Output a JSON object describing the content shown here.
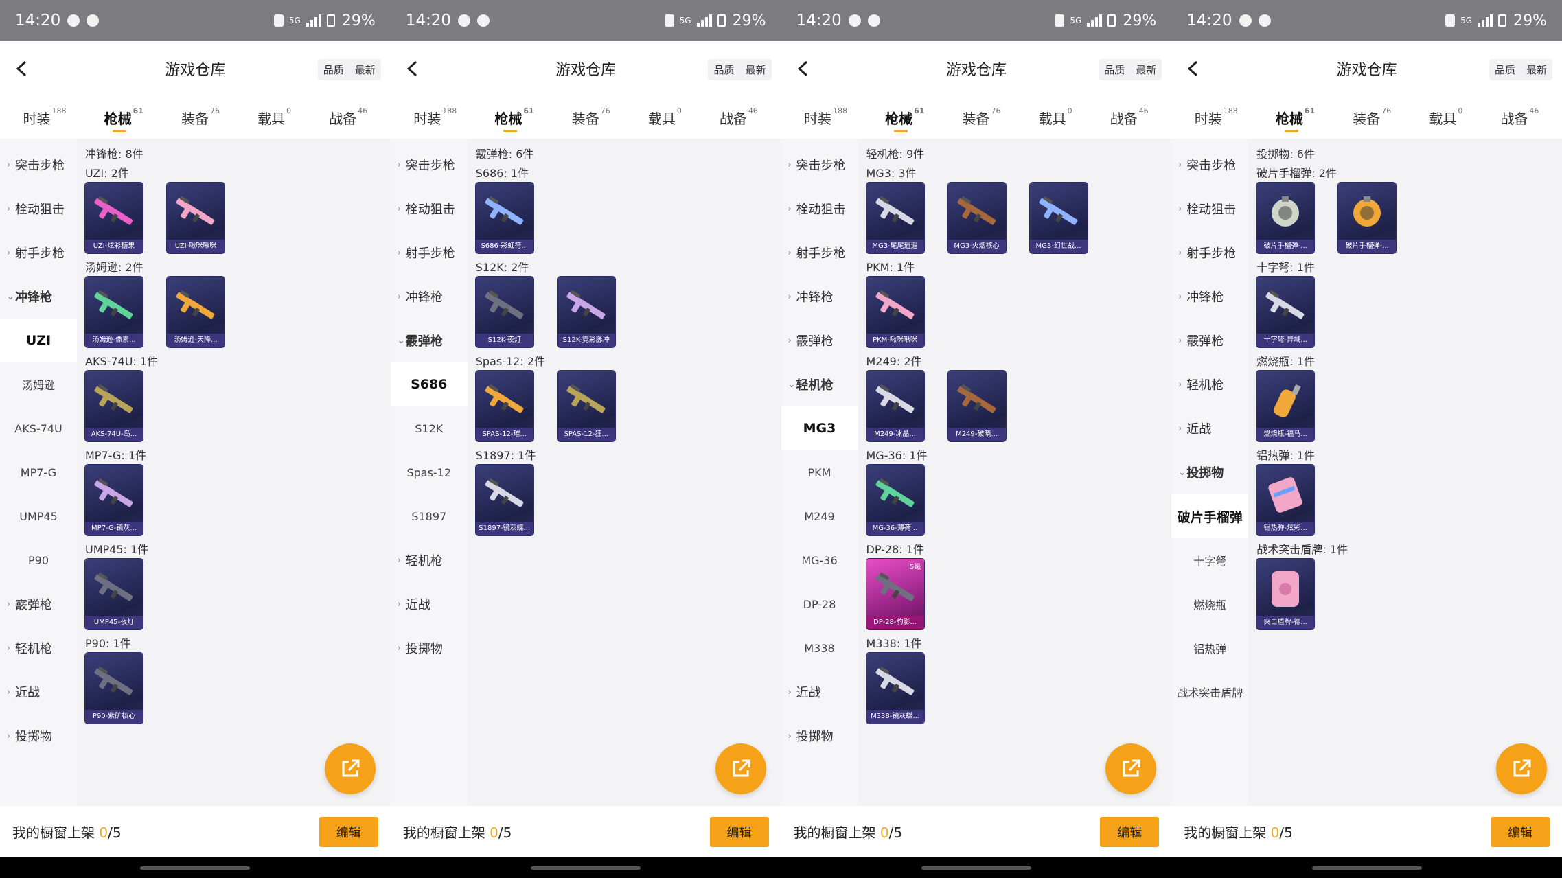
{
  "status": {
    "time": "14:20",
    "battery": "29%",
    "net": "5G"
  },
  "header": {
    "title": "游戏仓库",
    "sort_quality": "品质",
    "sort_latest": "最新"
  },
  "tabs": [
    {
      "label": "时装",
      "count": "188"
    },
    {
      "label": "枪械",
      "count": "61"
    },
    {
      "label": "装备",
      "count": "76"
    },
    {
      "label": "载具",
      "count": "0"
    },
    {
      "label": "战备",
      "count": "46"
    }
  ],
  "bottom": {
    "prefix": "我的橱窗上架 ",
    "count": "0",
    "suffix": "/5",
    "edit": "编辑"
  },
  "colors": {
    "accent": "#f5a219",
    "card": "#2a2d5e",
    "pink_card": "#c2339f"
  },
  "screens": [
    {
      "sidebar": [
        {
          "type": "cat",
          "label": "突击步枪"
        },
        {
          "type": "cat",
          "label": "栓动狙击"
        },
        {
          "type": "cat",
          "label": "射手步枪"
        },
        {
          "type": "cat",
          "label": "冲锋枪",
          "open": true
        },
        {
          "type": "sub",
          "label": "UZI",
          "sel": true
        },
        {
          "type": "sub",
          "label": "汤姆逊"
        },
        {
          "type": "sub",
          "label": "AKS-74U"
        },
        {
          "type": "sub",
          "label": "MP7-G"
        },
        {
          "type": "sub",
          "label": "UMP45"
        },
        {
          "type": "sub",
          "label": "P90"
        },
        {
          "type": "cat",
          "label": "霰弹枪"
        },
        {
          "type": "cat",
          "label": "轻机枪"
        },
        {
          "type": "cat",
          "label": "近战"
        },
        {
          "type": "cat",
          "label": "投掷物"
        }
      ],
      "content_title": "冲锋枪: 8件",
      "groups": [
        {
          "title": "UZI: 2件",
          "items": [
            {
              "label": "UZI-炫彩糖果",
              "hue": "pink"
            },
            {
              "label": "UZI-啾咪啾咪",
              "hue": "rose"
            }
          ]
        },
        {
          "title": "汤姆逊: 2件",
          "items": [
            {
              "label": "汤姆逊-像素...",
              "hue": "green"
            },
            {
              "label": "汤姆逊-天降...",
              "hue": "gold"
            }
          ]
        },
        {
          "title": "AKS-74U: 1件",
          "items": [
            {
              "label": "AKS-74U-岛...",
              "hue": "olive"
            }
          ]
        },
        {
          "title": "MP7-G: 1件",
          "items": [
            {
              "label": "MP7-G-镜灰...",
              "hue": "lilac"
            }
          ]
        },
        {
          "title": "UMP45: 1件",
          "items": [
            {
              "label": "UMP45-夜灯",
              "hue": "dark"
            }
          ]
        },
        {
          "title": "P90: 1件",
          "items": [
            {
              "label": "P90-紫矿核心",
              "hue": "dark"
            }
          ]
        }
      ]
    },
    {
      "sidebar": [
        {
          "type": "cat",
          "label": "突击步枪"
        },
        {
          "type": "cat",
          "label": "栓动狙击"
        },
        {
          "type": "cat",
          "label": "射手步枪"
        },
        {
          "type": "cat",
          "label": "冲锋枪"
        },
        {
          "type": "cat",
          "label": "霰弹枪",
          "open": true
        },
        {
          "type": "sub",
          "label": "S686",
          "sel": true
        },
        {
          "type": "sub",
          "label": "S12K"
        },
        {
          "type": "sub",
          "label": "Spas-12"
        },
        {
          "type": "sub",
          "label": "S1897"
        },
        {
          "type": "cat",
          "label": "轻机枪"
        },
        {
          "type": "cat",
          "label": "近战"
        },
        {
          "type": "cat",
          "label": "投掷物"
        }
      ],
      "content_title": "霰弹枪: 6件",
      "groups": [
        {
          "title": "S686: 1件",
          "items": [
            {
              "label": "S686-彩虹符...",
              "hue": "blue"
            }
          ]
        },
        {
          "title": "S12K: 2件",
          "items": [
            {
              "label": "S12K-夜灯",
              "hue": "dark"
            },
            {
              "label": "S12K-霓彩脉冲",
              "hue": "lilac"
            }
          ]
        },
        {
          "title": "Spas-12: 2件",
          "items": [
            {
              "label": "SPAS-12-璀...",
              "hue": "gold"
            },
            {
              "label": "SPAS-12-狂...",
              "hue": "olive"
            }
          ]
        },
        {
          "title": "S1897: 1件",
          "items": [
            {
              "label": "S1897-镜灰蝶...",
              "hue": "grey"
            }
          ]
        }
      ]
    },
    {
      "sidebar": [
        {
          "type": "cat",
          "label": "突击步枪"
        },
        {
          "type": "cat",
          "label": "栓动狙击"
        },
        {
          "type": "cat",
          "label": "射手步枪"
        },
        {
          "type": "cat",
          "label": "冲锋枪"
        },
        {
          "type": "cat",
          "label": "霰弹枪"
        },
        {
          "type": "cat",
          "label": "轻机枪",
          "open": true
        },
        {
          "type": "sub",
          "label": "MG3",
          "sel": true
        },
        {
          "type": "sub",
          "label": "PKM"
        },
        {
          "type": "sub",
          "label": "M249"
        },
        {
          "type": "sub",
          "label": "MG-36"
        },
        {
          "type": "sub",
          "label": "DP-28"
        },
        {
          "type": "sub",
          "label": "M338"
        },
        {
          "type": "cat",
          "label": "近战"
        },
        {
          "type": "cat",
          "label": "投掷物"
        }
      ],
      "content_title": "轻机枪: 9件",
      "groups": [
        {
          "title": "MG3: 3件",
          "items": [
            {
              "label": "MG3-尾尾逍遥",
              "hue": "grey"
            },
            {
              "label": "MG3-火烟核心",
              "hue": "brown"
            },
            {
              "label": "MG3-幻世战...",
              "hue": "blue"
            }
          ]
        },
        {
          "title": "PKM: 1件",
          "items": [
            {
              "label": "PKM-啾咪啾咪",
              "hue": "rose"
            }
          ]
        },
        {
          "title": "M249: 2件",
          "items": [
            {
              "label": "M249-冰晶...",
              "hue": "grey"
            },
            {
              "label": "M249-破晓...",
              "hue": "brown"
            }
          ]
        },
        {
          "title": "MG-36: 1件",
          "items": [
            {
              "label": "MG-36-薄荷...",
              "hue": "green"
            }
          ]
        },
        {
          "title": "DP-28: 1件",
          "items": [
            {
              "label": "DP-28-豹影...",
              "hue": "dark",
              "pink": true,
              "tag": "5级"
            }
          ]
        },
        {
          "title": "M338: 1件",
          "items": [
            {
              "label": "M338-镜灰蝶...",
              "hue": "grey"
            }
          ]
        }
      ]
    },
    {
      "sidebar": [
        {
          "type": "cat",
          "label": "突击步枪"
        },
        {
          "type": "cat",
          "label": "栓动狙击"
        },
        {
          "type": "cat",
          "label": "射手步枪"
        },
        {
          "type": "cat",
          "label": "冲锋枪"
        },
        {
          "type": "cat",
          "label": "霰弹枪"
        },
        {
          "type": "cat",
          "label": "轻机枪"
        },
        {
          "type": "cat",
          "label": "近战"
        },
        {
          "type": "cat",
          "label": "投掷物",
          "open": true
        },
        {
          "type": "sub",
          "label": "破片手榴弹",
          "sel": true
        },
        {
          "type": "sub",
          "label": "十字弩"
        },
        {
          "type": "sub",
          "label": "燃烧瓶"
        },
        {
          "type": "sub",
          "label": "铝热弹"
        },
        {
          "type": "sub",
          "label": "战术突击盾牌"
        }
      ],
      "content_title": "投掷物: 6件",
      "groups": [
        {
          "title": "破片手榴弹: 2件",
          "items": [
            {
              "label": "破片手榴弹-...",
              "hue": "gren",
              "kind": "ball"
            },
            {
              "label": "破片手榴弹-...",
              "hue": "gold",
              "kind": "ball"
            }
          ]
        },
        {
          "title": "十字弩: 1件",
          "items": [
            {
              "label": "十字弩-异域...",
              "hue": "grey"
            }
          ]
        },
        {
          "title": "燃烧瓶: 1件",
          "items": [
            {
              "label": "燃烧瓶-福马...",
              "hue": "gold",
              "kind": "bottle"
            }
          ]
        },
        {
          "title": "铝热弹: 1件",
          "items": [
            {
              "label": "铝热弹-炫彩...",
              "hue": "rose",
              "kind": "can"
            }
          ]
        },
        {
          "title": "战术突击盾牌: 1件",
          "items": [
            {
              "label": "突击盾牌-德...",
              "hue": "rose",
              "kind": "shield"
            }
          ]
        }
      ]
    }
  ]
}
